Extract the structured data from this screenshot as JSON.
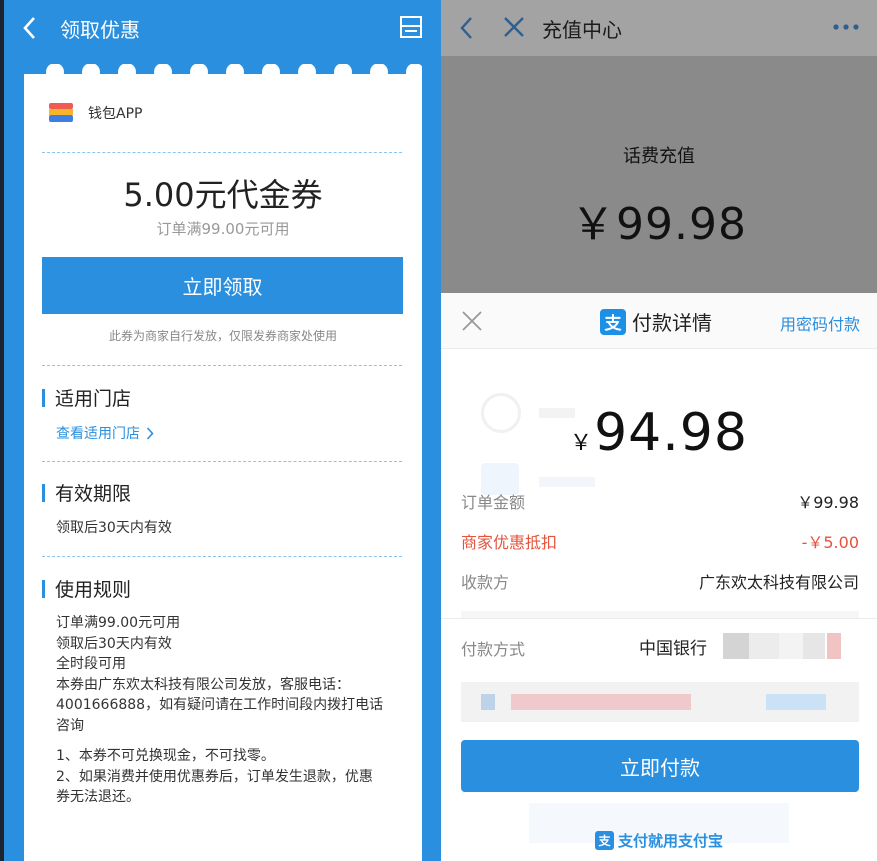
{
  "left": {
    "header": {
      "title": "领取优惠"
    },
    "merchant": {
      "name": "钱包APP"
    },
    "coupon": {
      "title": "5.00元代金券",
      "condition": "订单满99.00元可用",
      "claim_button": "立即领取",
      "note": "此券为商家自行发放，仅限发券商家处使用"
    },
    "stores": {
      "heading": "适用门店",
      "link": "查看适用门店"
    },
    "validity": {
      "heading": "有效期限",
      "text": "领取后30天内有效"
    },
    "rules": {
      "heading": "使用规则",
      "lines": [
        "订单满99.00元可用",
        "领取后30天内有效",
        "全时段可用",
        "本券由广东欢太科技有限公司发放，客服电话：",
        "4001666888，如有疑问请在工作时间段内拨打电话",
        "咨询"
      ],
      "terms": [
        "1、本券不可兑换现金，不可找零。",
        "2、如果消费并使用优惠券后，订单发生退款，优惠",
        "券无法退还。"
      ]
    }
  },
  "right": {
    "header": {
      "title": "充值中心"
    },
    "recharge": {
      "label": "话费充值",
      "price": "￥99.98"
    },
    "sheet": {
      "title": "付款详情",
      "password_pay": "用密码付款",
      "amount_currency": "￥",
      "amount": "94.98",
      "rows": [
        {
          "label": "订单金额",
          "value": "￥99.98"
        },
        {
          "label": "商家优惠抵扣",
          "value": "-￥5.00"
        },
        {
          "label": "收款方",
          "value": "广东欢太科技有限公司"
        }
      ],
      "payment_method": {
        "label": "付款方式",
        "value": "中国银行"
      },
      "pay_button": "立即付款",
      "footer": "支付就用支付宝"
    }
  },
  "colors": {
    "brand_blue": "#2a8fdf",
    "discount_red": "#e5533d"
  },
  "icons": [
    "chevron-left-icon",
    "close-icon",
    "more-icon",
    "menu-card-icon",
    "wallet-logo-icon",
    "alipay-icon",
    "chevron-right-icon"
  ]
}
